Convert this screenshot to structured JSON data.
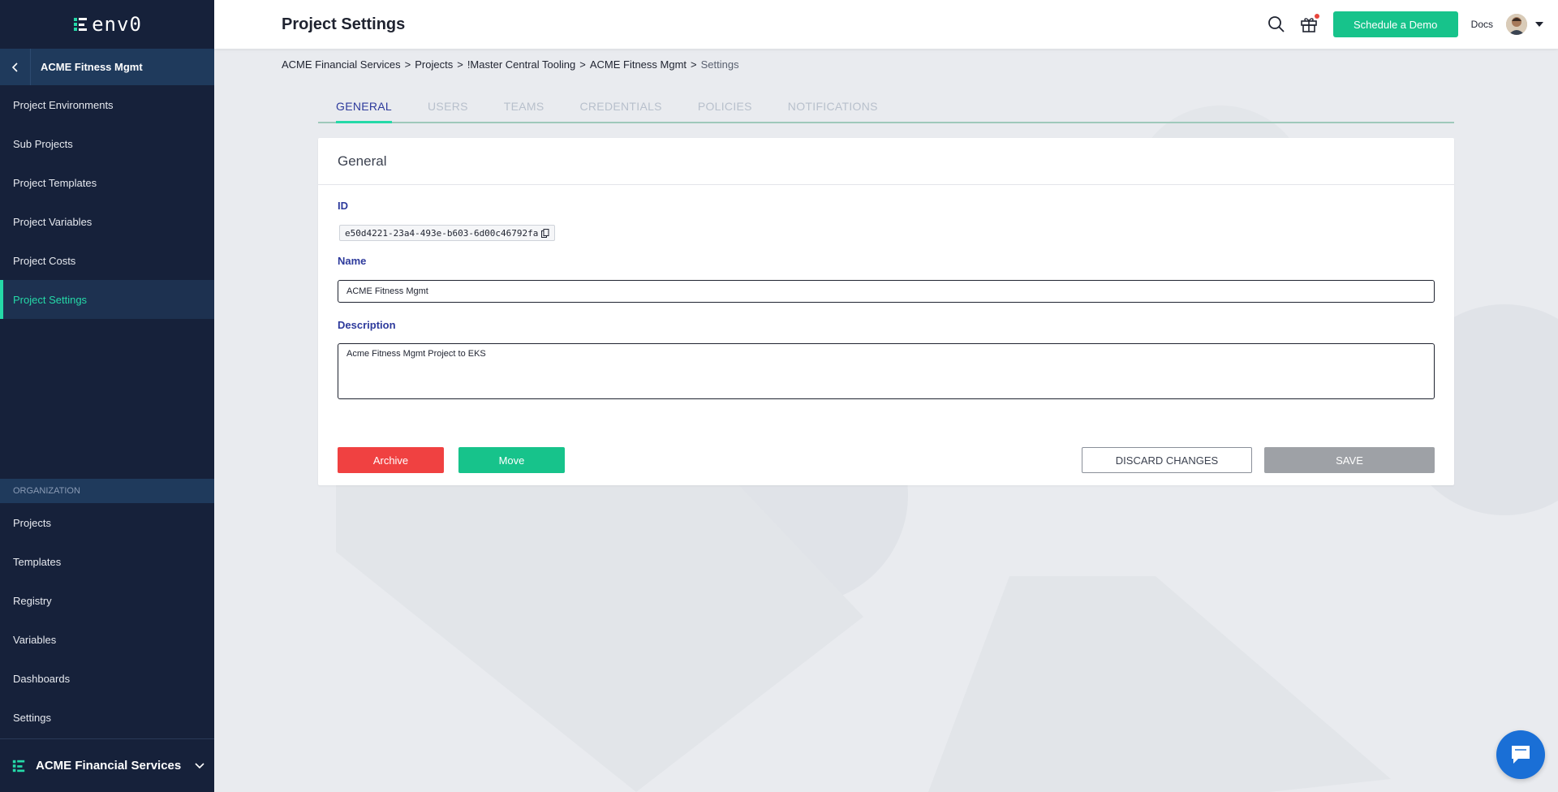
{
  "app": {
    "logo_text": "env0",
    "page_title": "Project Settings"
  },
  "sidebar": {
    "project_name": "ACME Fitness Mgmt",
    "project_items": [
      {
        "label": "Project Environments"
      },
      {
        "label": "Sub Projects"
      },
      {
        "label": "Project Templates"
      },
      {
        "label": "Project Variables"
      },
      {
        "label": "Project Costs"
      },
      {
        "label": "Project Settings"
      }
    ],
    "active_item": "Project Settings",
    "org_section_label": "ORGANIZATION",
    "org_items": [
      {
        "label": "Projects"
      },
      {
        "label": "Templates"
      },
      {
        "label": "Registry"
      },
      {
        "label": "Variables"
      },
      {
        "label": "Dashboards"
      },
      {
        "label": "Settings"
      }
    ],
    "org_name": "ACME Financial Services"
  },
  "topbar": {
    "demo_label": "Schedule a Demo",
    "docs_label": "Docs"
  },
  "breadcrumb": {
    "items": [
      "ACME Financial Services",
      "Projects",
      "!Master Central Tooling",
      "ACME Fitness Mgmt"
    ],
    "separator": ">",
    "current": "Settings"
  },
  "tabs": [
    {
      "label": "GENERAL",
      "active": true
    },
    {
      "label": "USERS",
      "active": false
    },
    {
      "label": "TEAMS",
      "active": false
    },
    {
      "label": "CREDENTIALS",
      "active": false
    },
    {
      "label": "POLICIES",
      "active": false
    },
    {
      "label": "NOTIFICATIONS",
      "active": false
    }
  ],
  "general": {
    "title": "General",
    "id_label": "ID",
    "id_value": "e50d4221-23a4-493e-b603-6d00c46792fa",
    "name_label": "Name",
    "name_value": "ACME Fitness Mgmt",
    "description_label": "Description",
    "description_value": "Acme Fitness Mgmt Project to EKS",
    "archive_label": "Archive",
    "move_label": "Move",
    "discard_label": "DISCARD CHANGES",
    "save_label": "SAVE"
  },
  "colors": {
    "sidebar_bg": "#16213a",
    "accent_green": "#25d9a8",
    "demo_button": "#17c38b",
    "archive_red": "#f04141",
    "label_blue": "#2d3a9c",
    "save_disabled": "#9ea1a6"
  }
}
